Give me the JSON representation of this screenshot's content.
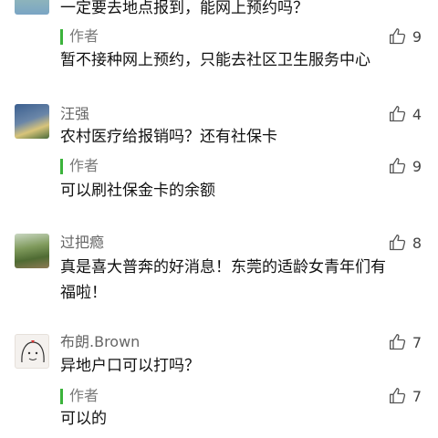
{
  "comments": [
    {
      "author": "",
      "text": "一定要去地点报到，能网上预约吗？",
      "reply": {
        "author": "作者",
        "text": "暂不接种网上预约，只能去社区卫生服务中心",
        "likes": "9"
      }
    },
    {
      "author": "汪强",
      "text": "农村医疗给报销吗？还有社保卡",
      "likes": "4",
      "reply": {
        "author": "作者",
        "text": "可以刷社保金卡的余额",
        "likes": "9"
      }
    },
    {
      "author": "过把瘾",
      "text_line1": "真是喜大普奔的好消息！东莞的适龄女青年们有",
      "text_line2": "福啦！",
      "likes": "8"
    },
    {
      "author": "布朗.Brown",
      "text": "异地户口可以打吗？",
      "likes": "7",
      "reply": {
        "author": "作者",
        "text": "可以的",
        "likes": "7"
      }
    }
  ],
  "icons": {
    "like": "thumbs-up-icon"
  },
  "colors": {
    "reply_bar": "#3cb33c",
    "name": "#666666"
  }
}
